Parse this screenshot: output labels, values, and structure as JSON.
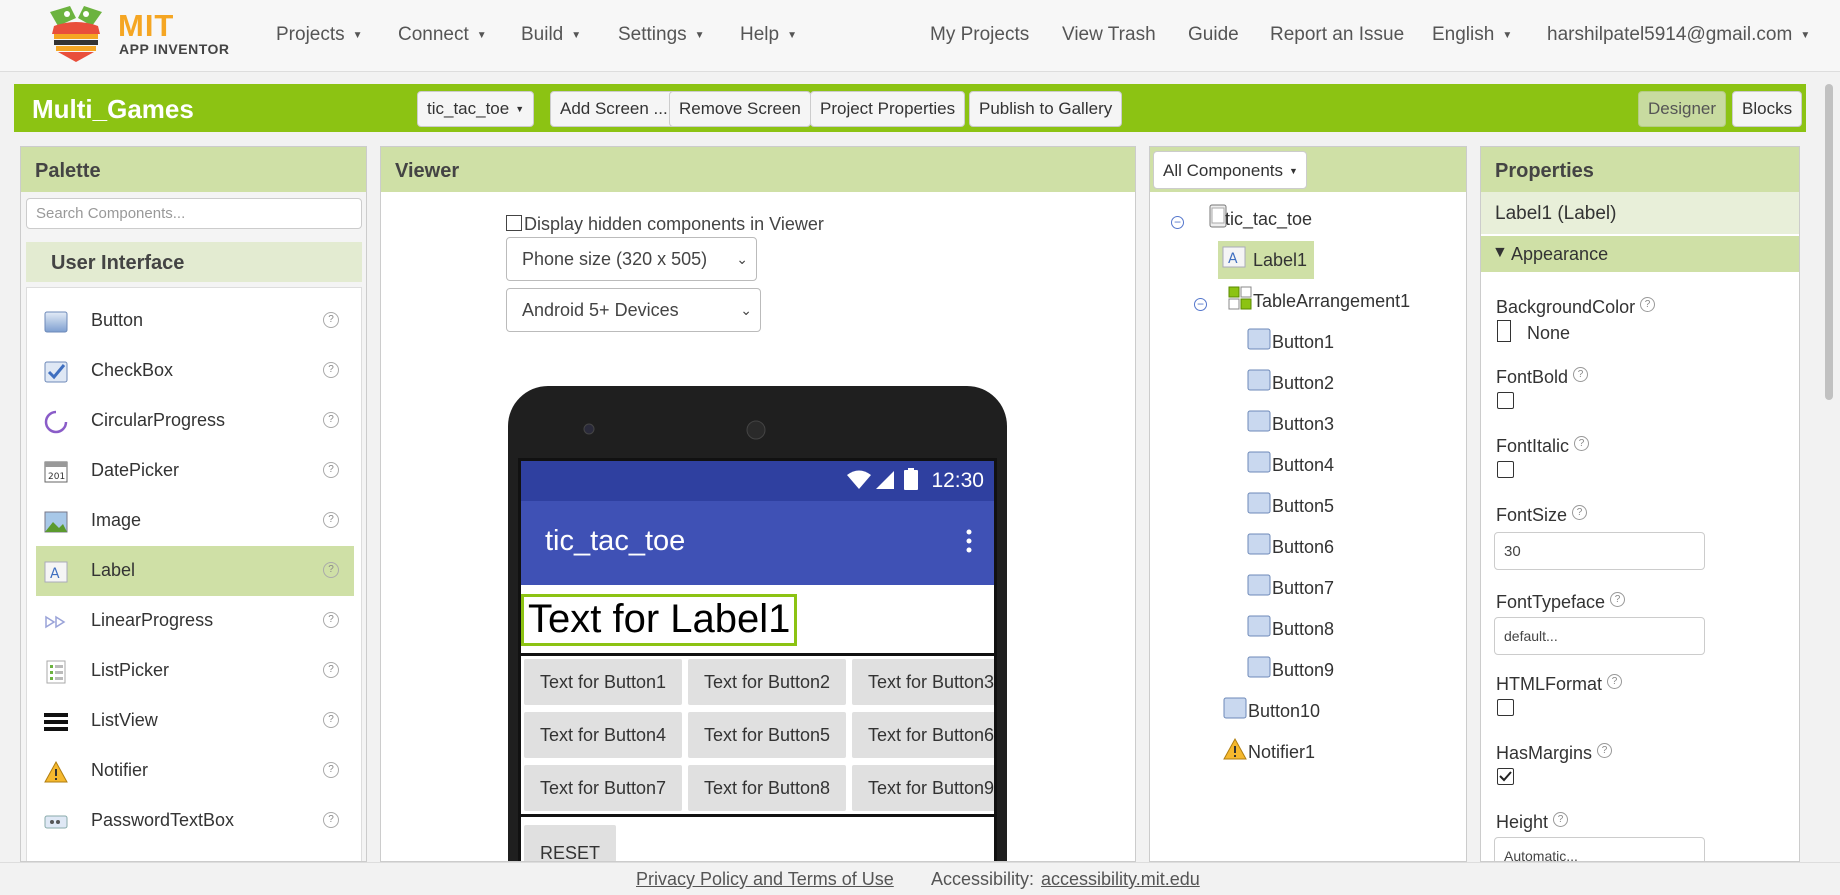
{
  "nav": {
    "logo_title": "MIT",
    "logo_subtitle": "APP INVENTOR",
    "menus": [
      "Projects",
      "Connect",
      "Build",
      "Settings",
      "Help"
    ],
    "links": [
      "My Projects",
      "View Trash",
      "Guide",
      "Report an Issue"
    ],
    "language": "English",
    "account": "harshilpatel5914@gmail.com"
  },
  "toolbar": {
    "project_name": "Multi_Games",
    "screen_select": "tic_tac_toe",
    "add_screen": "Add Screen ...",
    "remove_screen": "Remove Screen",
    "project_properties": "Project Properties",
    "publish": "Publish to Gallery",
    "designer": "Designer",
    "blocks": "Blocks"
  },
  "palette": {
    "title": "Palette",
    "search_placeholder": "Search Components...",
    "category": "User Interface",
    "items": [
      {
        "label": "Button",
        "icon": "button-icon"
      },
      {
        "label": "CheckBox",
        "icon": "checkbox-icon"
      },
      {
        "label": "CircularProgress",
        "icon": "circular-progress-icon"
      },
      {
        "label": "DatePicker",
        "icon": "datepicker-icon"
      },
      {
        "label": "Image",
        "icon": "image-icon"
      },
      {
        "label": "Label",
        "icon": "label-icon"
      },
      {
        "label": "LinearProgress",
        "icon": "linear-progress-icon"
      },
      {
        "label": "ListPicker",
        "icon": "listpicker-icon"
      },
      {
        "label": "ListView",
        "icon": "listview-icon"
      },
      {
        "label": "Notifier",
        "icon": "notifier-icon"
      },
      {
        "label": "PasswordTextBox",
        "icon": "password-textbox-icon"
      }
    ],
    "help_glyph": "?"
  },
  "viewer": {
    "title": "Viewer",
    "hidden_components": "Display hidden components in Viewer",
    "size_select": "Phone size (320 x 505)",
    "device_select": "Android 5+ Devices",
    "status_time": "12:30",
    "app_title": "tic_tac_toe",
    "label1_text": "Text for Label1",
    "grid_buttons": [
      "Text for Button1",
      "Text for Button2",
      "Text for Button3",
      "Text for Button4",
      "Text for Button5",
      "Text for Button6",
      "Text for Button7",
      "Text for Button8",
      "Text for Button9"
    ],
    "reset": "RESET"
  },
  "components": {
    "filter": "All Components",
    "tree": {
      "root": "tic_tac_toe",
      "label": "Label1",
      "arrangement": "TableArrangement1",
      "buttons": [
        "Button1",
        "Button2",
        "Button3",
        "Button4",
        "Button5",
        "Button6",
        "Button7",
        "Button8",
        "Button9"
      ],
      "button10": "Button10",
      "notifier": "Notifier1"
    },
    "collapse_glyph": "−"
  },
  "properties": {
    "title": "Properties",
    "component": "Label1 (Label)",
    "section": "Appearance",
    "background_color": {
      "label": "BackgroundColor",
      "value": "None"
    },
    "font_bold": {
      "label": "FontBold",
      "checked": false
    },
    "font_italic": {
      "label": "FontItalic",
      "checked": false
    },
    "font_size": {
      "label": "FontSize",
      "value": "30"
    },
    "font_typeface": {
      "label": "FontTypeface",
      "value": "default..."
    },
    "html_format": {
      "label": "HTMLFormat",
      "checked": false
    },
    "has_margins": {
      "label": "HasMargins",
      "checked": true
    },
    "height": {
      "label": "Height",
      "value": "Automatic..."
    }
  },
  "footer": {
    "privacy": "Privacy Policy and Terms of Use",
    "accessibility_label": "Accessibility:",
    "accessibility_link": "accessibility.mit.edu"
  },
  "colors": {
    "brand_green": "#8cc313",
    "panel_header": "#cfe0a6",
    "app_bar": "#3f51b5",
    "status_bar": "#2f40a0"
  }
}
